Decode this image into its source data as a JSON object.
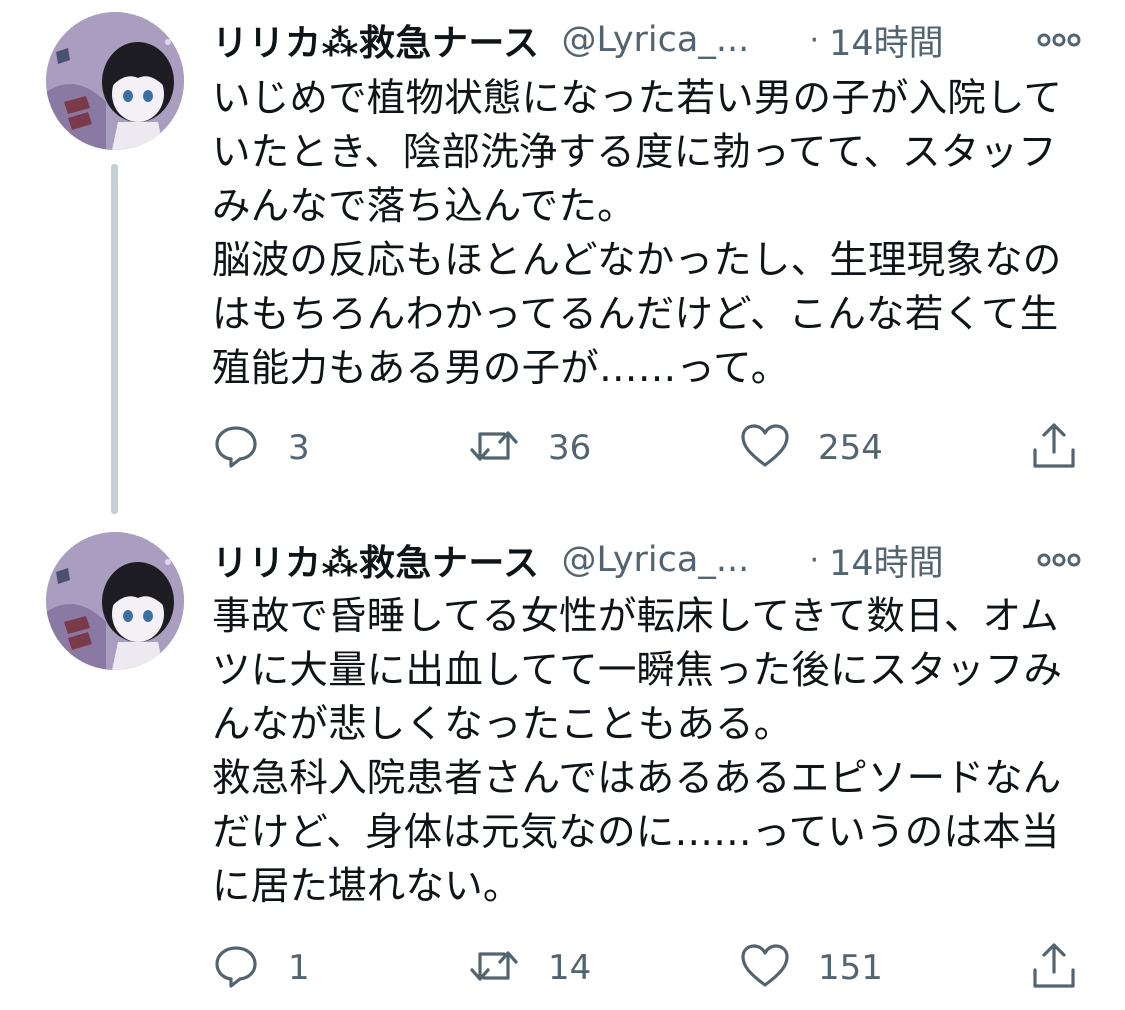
{
  "tweets": [
    {
      "display_name": "リリカ⁂救急ナース",
      "handle": "@Lyrica_...",
      "separator": "·",
      "time": "14時間",
      "text": "いじめで植物状態になった若い男の子が入院して\nいたとき、陰部洗浄する度に勃ってて、スタッフ\nみんなで落ち込んでた。\n脳波の反応もほとんどなかったし、生理現象なの\nはもちろんわかってるんだけど、こんな若くて生\n殖能力もある男の子が……って。",
      "replies": "3",
      "retweets": "36",
      "likes": "254"
    },
    {
      "display_name": "リリカ⁂救急ナース",
      "handle": "@Lyrica_...",
      "separator": "·",
      "time": "14時間",
      "text": "事故で昏睡してる女性が転床してきて数日、オム\nツに大量に出血してて一瞬焦った後にスタッフみ\nんなが悲しくなったこともある。\n救急科入院患者さんではあるあるエピソードなん\nだけど、身体は元気なのに……っていうのは本当\nに居た堪れない。",
      "replies": "1",
      "retweets": "14",
      "likes": "151"
    }
  ],
  "icons": {
    "reply": "reply-icon",
    "retweet": "retweet-icon",
    "like": "heart-icon",
    "share": "share-icon",
    "more": "more-icon"
  },
  "colors": {
    "text": "#0f1419",
    "secondary": "#536471",
    "thread_line": "#c4cfd6",
    "background": "#ffffff"
  }
}
